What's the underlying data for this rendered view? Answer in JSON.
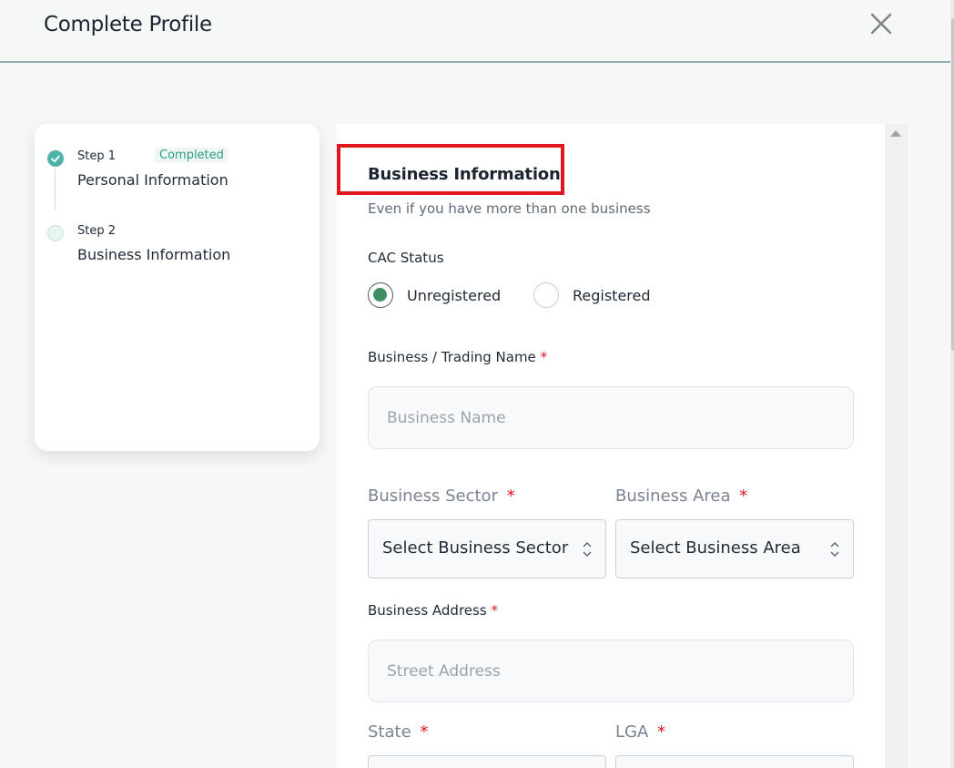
{
  "header": {
    "title": "Complete Profile",
    "close_icon": "close-icon"
  },
  "stepper": {
    "steps": [
      {
        "number": "Step 1",
        "name": "Personal Information",
        "badge": "Completed",
        "status": "completed"
      },
      {
        "number": "Step 2",
        "name": "Business Information",
        "status": "current"
      }
    ]
  },
  "form": {
    "title": "Business Information",
    "subtitle": "Even if you have more than one business",
    "cac_status": {
      "label": "CAC Status",
      "options": [
        "Unregistered",
        "Registered"
      ],
      "selected": "Unregistered"
    },
    "business_name": {
      "label": "Business / Trading Name",
      "required_mark": "*",
      "placeholder": "Business Name",
      "value": ""
    },
    "business_sector": {
      "label": "Business Sector",
      "required_mark": "*",
      "selected": "Select Business Sector"
    },
    "business_area": {
      "label": "Business Area",
      "required_mark": "*",
      "selected": "Select Business Area"
    },
    "business_address": {
      "label": "Business Address",
      "required_mark": "*",
      "placeholder": "Street Address",
      "value": ""
    },
    "state": {
      "label": "State",
      "required_mark": "*"
    },
    "lga": {
      "label": "LGA",
      "required_mark": "*"
    }
  },
  "colors": {
    "accent_green": "#3f8f61",
    "step_teal": "#4fb3a8",
    "badge_text": "#2f9b82",
    "required_red": "#e0171d",
    "highlight_red": "#e0171d"
  }
}
